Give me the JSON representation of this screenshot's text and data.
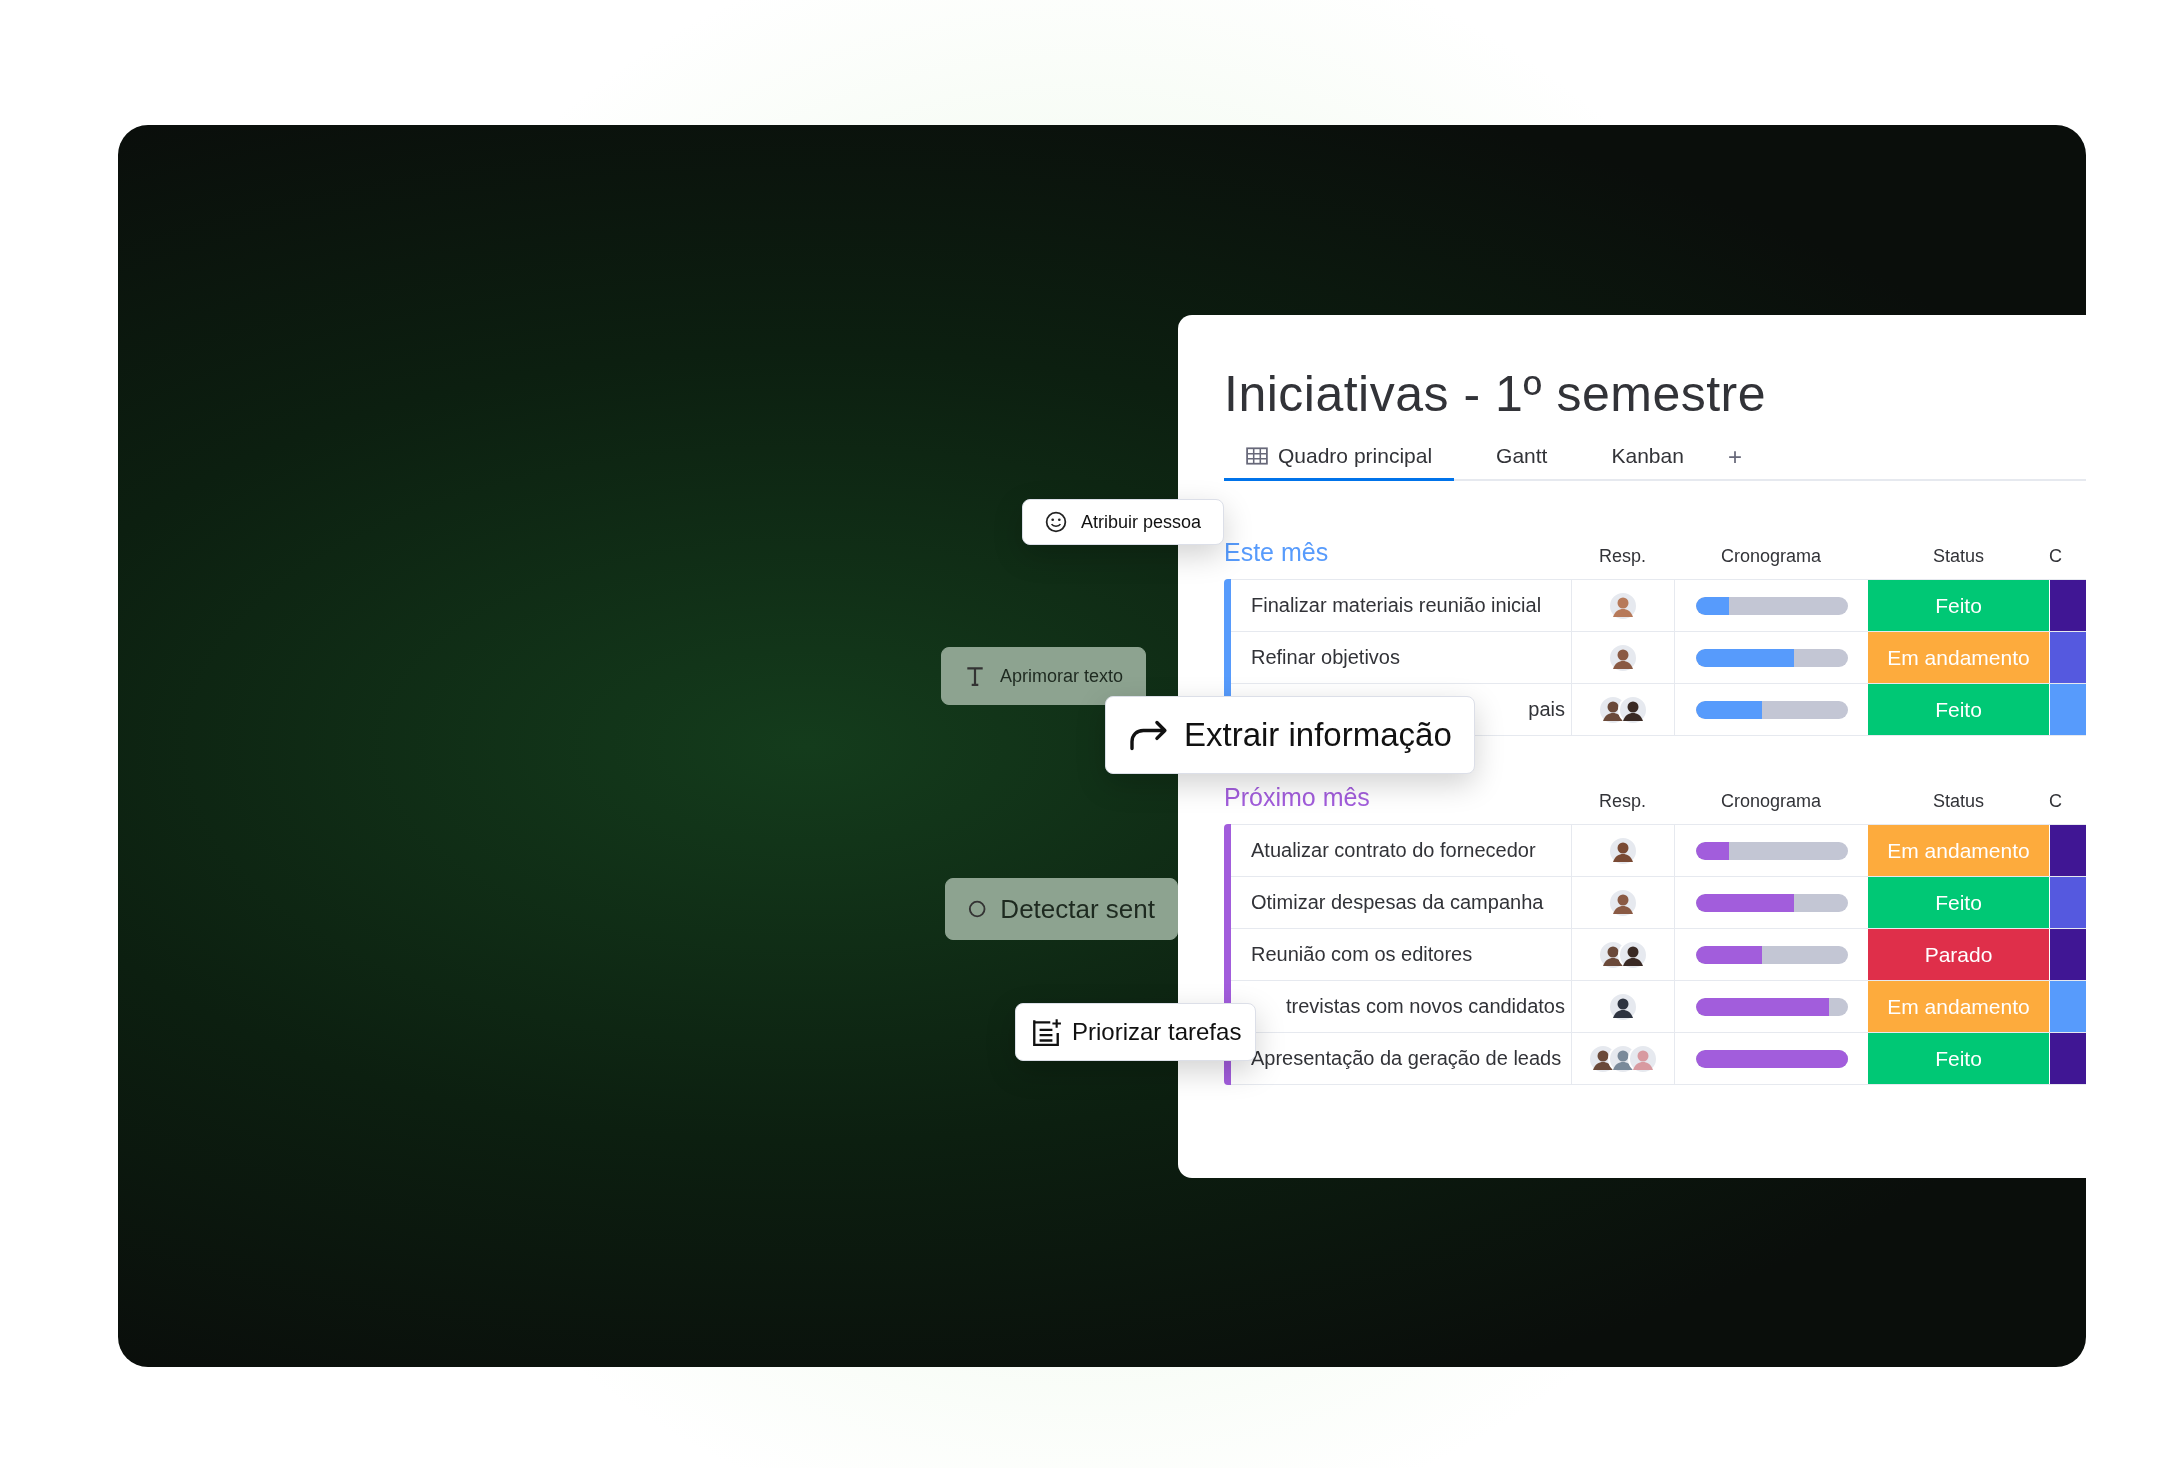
{
  "board": {
    "title": "Iniciativas - 1º semestre",
    "tabs": [
      {
        "label": "Quadro principal",
        "selected": true,
        "kind": "table"
      },
      {
        "label": "Gantt",
        "selected": false
      },
      {
        "label": "Kanban",
        "selected": false
      }
    ],
    "add_tab": "+",
    "groups": [
      {
        "title": "Este mês",
        "color": "#579bfc",
        "columns": [
          "Resp.",
          "Cronograma",
          "Status",
          "C"
        ],
        "rows": [
          {
            "name": "Finalizar materiais reunião inicial",
            "partial": false,
            "avatars": [
              {
                "color": "#b77a5a"
              }
            ],
            "level": 0.22,
            "status": {
              "label": "Feito",
              "color": "#00c875"
            },
            "column_5": {
              "color": "#401694"
            }
          },
          {
            "name": "Refinar objetivos",
            "partial": false,
            "avatars": [
              {
                "color": "#8a5a44"
              }
            ],
            "level": 0.65,
            "status": {
              "label": "Em andamento",
              "color": "#fdab3d"
            },
            "column_5": {
              "color": "#5559df"
            }
          },
          {
            "name": "pais",
            "partial": true,
            "avatars": [
              {
                "color": "#6b4a3a"
              },
              {
                "color": "#3a2a24"
              }
            ],
            "level": 0.44,
            "status": {
              "label": "Feito",
              "color": "#00c875"
            },
            "column_5": {
              "color": "#579bfc"
            }
          }
        ]
      },
      {
        "title": "Próximo mês",
        "color": "#a25ddc",
        "columns": [
          "Resp.",
          "Cronograma",
          "Status",
          "C"
        ],
        "rows": [
          {
            "name": "Atualizar contrato do fornecedor",
            "partial": false,
            "avatars": [
              {
                "color": "#7a4a34"
              }
            ],
            "level": 0.22,
            "status": {
              "label": "Em andamento",
              "color": "#fdab3d"
            },
            "column_5": {
              "color": "#401694"
            }
          },
          {
            "name": "Otimizar despesas da campanha",
            "partial": false,
            "avatars": [
              {
                "color": "#8a5a44"
              }
            ],
            "level": 0.65,
            "status": {
              "label": "Feito",
              "color": "#00c875"
            },
            "column_5": {
              "color": "#5559df"
            }
          },
          {
            "name": "Reunião com os editores",
            "partial": false,
            "avatars": [
              {
                "color": "#6b4a3a"
              },
              {
                "color": "#3a2a24"
              }
            ],
            "level": 0.44,
            "status": {
              "label": "Parado",
              "color": "#df2f4a"
            },
            "column_5": {
              "color": "#401694"
            }
          },
          {
            "name": "trevistas com novos candidatos",
            "partial": true,
            "avatars": [
              {
                "color": "#2e3440"
              }
            ],
            "level": 0.88,
            "status": {
              "label": "Em andamento",
              "color": "#fdab3d"
            },
            "column_5": {
              "color": "#579bfc"
            }
          },
          {
            "name": "Apresentação da geração de leads",
            "partial": false,
            "avatars": [
              {
                "color": "#6b4a3a"
              },
              {
                "color": "#7a8a9a"
              },
              {
                "color": "#d89aa0"
              }
            ],
            "level": 1.0,
            "status": {
              "label": "Feito",
              "color": "#00c875"
            },
            "column_5": {
              "color": "#401694"
            }
          }
        ]
      }
    ]
  },
  "chips": [
    {
      "label": "Atribuir pessoa",
      "kind": "smiley",
      "blurred": false
    },
    {
      "label": "Aprimorar texto",
      "kind": "text",
      "blurred": true
    },
    {
      "label": "Extrair informação",
      "kind": "arrow",
      "blurred": false
    },
    {
      "label": "Detectar sent",
      "kind": "circle",
      "blurred": true
    },
    {
      "label": "Priorizar tarefas",
      "kind": "list",
      "blurred": false
    }
  ]
}
